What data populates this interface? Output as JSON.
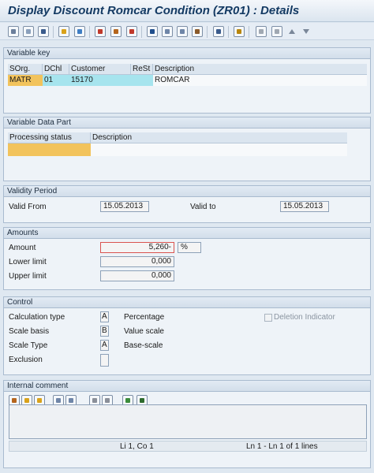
{
  "window": {
    "title": "Display Discount Romcar Condition (ZR01) : Details"
  },
  "toolbar": {
    "icons": [
      "other-condition-icon",
      "find-icon",
      "save-icon",
      "new-entries-icon",
      "copy-icon",
      "display-icon",
      "print-icon",
      "check-icon",
      "info-icon",
      "details-icon",
      "condition-rec-icon",
      "scales-icon",
      "user-icon",
      "export-icon",
      "first-page-icon",
      "last-page-icon",
      "up-arrow-icon",
      "down-arrow-icon"
    ]
  },
  "variable_key": {
    "title": "Variable key",
    "headers": [
      "SOrg.",
      "DChl",
      "Customer",
      "ReSt",
      "Description"
    ],
    "row": [
      "MATR",
      "01",
      "15170",
      "",
      "ROMCAR"
    ]
  },
  "variable_data": {
    "title": "Variable Data Part",
    "headers": [
      "Processing status",
      "Description"
    ]
  },
  "validity": {
    "title": "Validity Period",
    "valid_from_label": "Valid From",
    "valid_from": "15.05.2013",
    "valid_to_label": "Valid to",
    "valid_to": "15.05.2013"
  },
  "amounts": {
    "title": "Amounts",
    "amount_label": "Amount",
    "amount_value": "5,260-",
    "amount_unit": "%",
    "lower_label": "Lower limit",
    "lower_value": "0,000",
    "upper_label": "Upper limit",
    "upper_value": "0,000"
  },
  "control": {
    "title": "Control",
    "calc_type_label": "Calculation type",
    "calc_type_code": "A",
    "calc_type_text": "Percentage",
    "scale_basis_label": "Scale basis",
    "scale_basis_code": "B",
    "scale_basis_text": "Value scale",
    "scale_type_label": "Scale Type",
    "scale_type_code": "A",
    "scale_type_text": "Base-scale",
    "exclusion_label": "Exclusion",
    "exclusion_code": "",
    "deletion_label": "Deletion Indicator"
  },
  "comment": {
    "title": "Internal comment",
    "status_pos": "Li 1, Co 1",
    "status_lines": "Ln 1 - Ln 1 of 1 lines"
  }
}
